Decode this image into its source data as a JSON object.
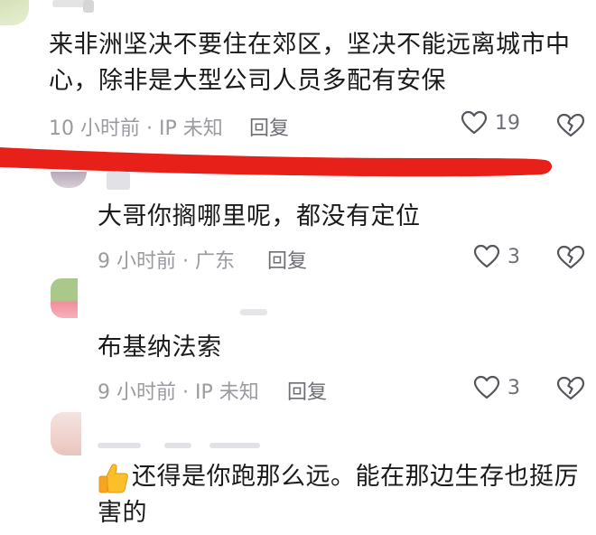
{
  "comments": [
    {
      "text_lines": [
        "来非洲坚决不要住在郊区，坚决不能远离城市中",
        "心，除非是大型公司人员多配有安保"
      ],
      "time": "10 小时前 · IP 未知",
      "reply_label": "回复",
      "likes": "19"
    },
    {
      "text_lines": [
        "大哥你搁哪里呢，都没有定位"
      ],
      "time": "9 小时前 · 广东",
      "reply_label": "回复",
      "likes": "3"
    },
    {
      "text_lines": [
        "布基纳法索"
      ],
      "time": "9 小时前 · IP 未知",
      "reply_label": "回复",
      "likes": "3"
    },
    {
      "text_lines": [
        "还得是你跑那么远。能在那边生存也挺厉",
        "害的"
      ],
      "emoji": "thumbs-up"
    }
  ],
  "icons": {
    "like": "heart-outline-icon",
    "dislike": "broken-heart-icon"
  },
  "colors": {
    "annotation_red": "#e8201a",
    "meta_gray": "#9a9aa0"
  }
}
